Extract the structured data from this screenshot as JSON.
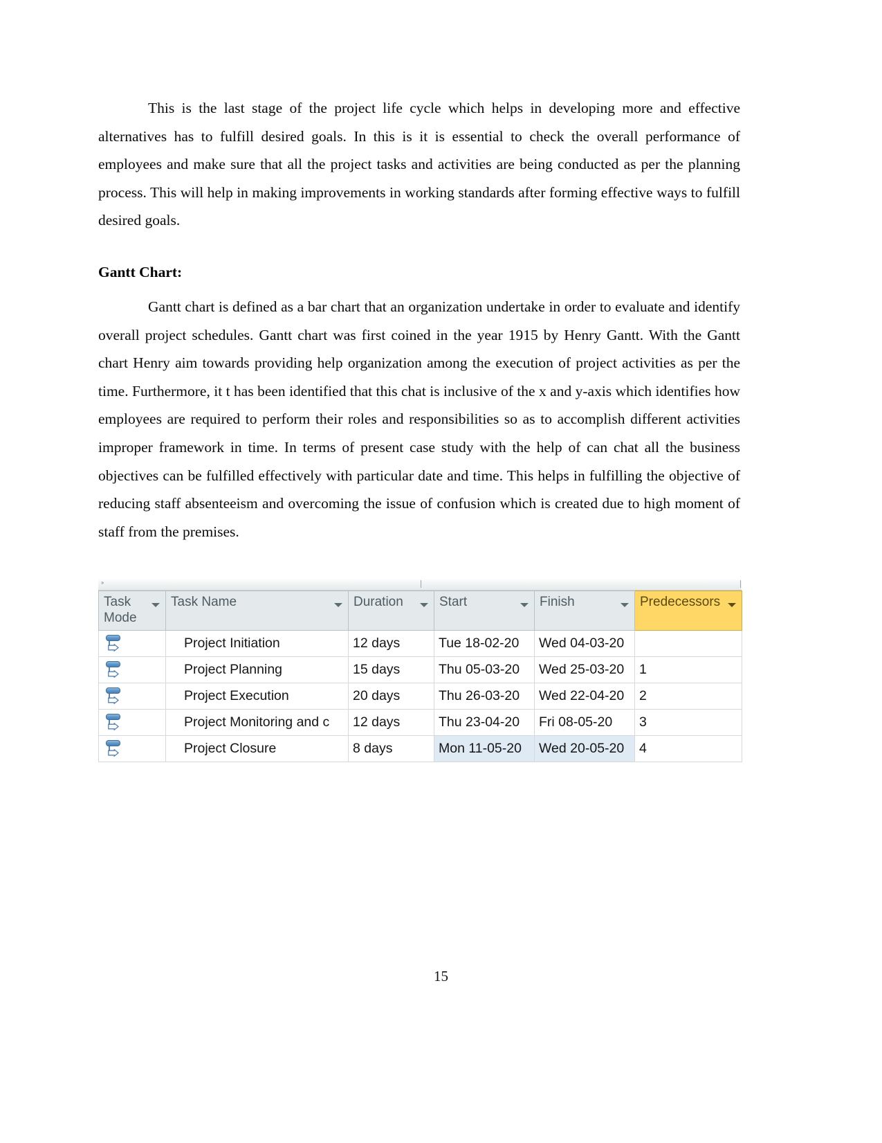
{
  "document": {
    "page_number": "15",
    "paragraphs": [
      {
        "id": "intro",
        "text": "This is the last stage of the project life cycle which helps in developing more and effective alternatives has to fulfill desired goals. In this is it is essential to check the overall performance of employees and make sure that all the project tasks and activities are being conducted as per the planning process. This will help in making improvements in working standards after forming effective ways to fulfill desired goals."
      },
      {
        "id": "gantt-body",
        "text": "Gantt chart is defined as a bar chart that an organization undertake in order to evaluate and identify overall project schedules. Gantt chart was first coined in the year 1915 by Henry Gantt. With the Gantt chart Henry aim towards providing help organization among the execution of project activities as per the time. Furthermore, it t has been identified that this chat is inclusive of the x and y-axis which identifies how employees are required to perform their roles and responsibilities so as to accomplish different activities improper framework in time. In terms of present case study with the help of can chat all the business objectives can be fulfilled effectively with particular date and time. This helps in fulfilling the objective of reducing staff absenteeism and overcoming the issue of confusion which is created due to high moment of staff from the premises."
      }
    ],
    "heading": "Gantt Chart:"
  },
  "project_table": {
    "columns": [
      {
        "key": "task_mode",
        "label": "Task Mode",
        "highlighted": false
      },
      {
        "key": "task_name",
        "label": "Task Name",
        "highlighted": false
      },
      {
        "key": "duration",
        "label": "Duration",
        "highlighted": false
      },
      {
        "key": "start",
        "label": "Start",
        "highlighted": false
      },
      {
        "key": "finish",
        "label": "Finish",
        "highlighted": false
      },
      {
        "key": "predecessors",
        "label": "Predecessors",
        "highlighted": true
      }
    ],
    "rows": [
      {
        "task_mode_icon": "auto-scheduled-icon",
        "task_name": "Project Initiation",
        "duration": "12 days",
        "start": "Tue 18-02-20",
        "finish": "Wed 04-03-20",
        "predecessors": "",
        "selected": false
      },
      {
        "task_mode_icon": "auto-scheduled-icon",
        "task_name": "Project Planning",
        "duration": "15 days",
        "start": "Thu 05-03-20",
        "finish": "Wed 25-03-20",
        "predecessors": "1",
        "selected": false
      },
      {
        "task_mode_icon": "auto-scheduled-icon",
        "task_name": "Project Execution",
        "duration": "20 days",
        "start": "Thu 26-03-20",
        "finish": "Wed 22-04-20",
        "predecessors": "2",
        "selected": false
      },
      {
        "task_mode_icon": "auto-scheduled-icon",
        "task_name": "Project Monitoring and c",
        "duration": "12 days",
        "start": "Thu 23-04-20",
        "finish": "Fri 08-05-20",
        "predecessors": "3",
        "selected": false
      },
      {
        "task_mode_icon": "auto-scheduled-icon",
        "task_name": "Project Closure",
        "duration": "8 days",
        "start": "Mon 11-05-20",
        "finish": "Wed 20-05-20",
        "predecessors": "4",
        "selected": true
      }
    ],
    "colors": {
      "header_background": "#e4e9ec",
      "predecessor_header_background": "#ffd766",
      "selection_background": "#dfeaf4",
      "grid_line": "#d3d9dc"
    }
  }
}
